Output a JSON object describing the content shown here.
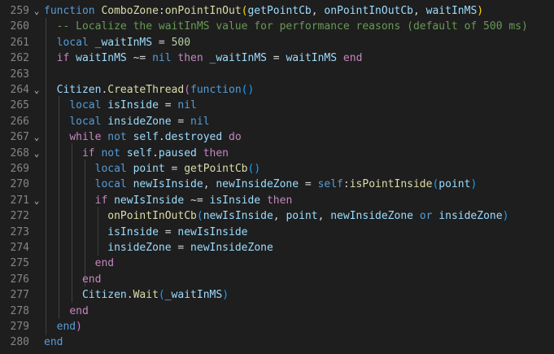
{
  "lines": [
    {
      "n": "259",
      "fold": "⌄",
      "t": [
        [
          "kw",
          "function"
        ],
        [
          "op",
          " "
        ],
        [
          "fn",
          "ComboZone"
        ],
        [
          "op",
          ":"
        ],
        [
          "fn",
          "onPointInOut"
        ],
        [
          "p1",
          "("
        ],
        [
          "var",
          "getPointCb"
        ],
        [
          "op",
          ", "
        ],
        [
          "var",
          "onPointInOutCb"
        ],
        [
          "op",
          ", "
        ],
        [
          "var",
          "waitInMS"
        ],
        [
          "p1",
          ")"
        ]
      ]
    },
    {
      "n": "260",
      "fold": "",
      "t": [
        [
          "op",
          "  "
        ],
        [
          "cm",
          "-- Localize the waitInMS value for performance reasons (default of 500 ms)"
        ]
      ]
    },
    {
      "n": "261",
      "fold": "",
      "t": [
        [
          "op",
          "  "
        ],
        [
          "kw",
          "local"
        ],
        [
          "op",
          " "
        ],
        [
          "var",
          "_waitInMS"
        ],
        [
          "op",
          " = "
        ],
        [
          "num",
          "500"
        ]
      ]
    },
    {
      "n": "262",
      "fold": "",
      "t": [
        [
          "op",
          "  "
        ],
        [
          "ctl",
          "if"
        ],
        [
          "op",
          " "
        ],
        [
          "var",
          "waitInMS"
        ],
        [
          "op",
          " ~= "
        ],
        [
          "kw",
          "nil"
        ],
        [
          "op",
          " "
        ],
        [
          "ctl",
          "then"
        ],
        [
          "op",
          " "
        ],
        [
          "var",
          "_waitInMS"
        ],
        [
          "op",
          " = "
        ],
        [
          "var",
          "waitInMS"
        ],
        [
          "op",
          " "
        ],
        [
          "ctl",
          "end"
        ]
      ]
    },
    {
      "n": "263",
      "fold": "",
      "t": []
    },
    {
      "n": "264",
      "fold": "⌄",
      "t": [
        [
          "op",
          "  "
        ],
        [
          "var",
          "Citizen"
        ],
        [
          "op",
          "."
        ],
        [
          "fn",
          "CreateThread"
        ],
        [
          "p2",
          "("
        ],
        [
          "kw",
          "function"
        ],
        [
          "p3",
          "()"
        ]
      ]
    },
    {
      "n": "265",
      "fold": "",
      "t": [
        [
          "op",
          "    "
        ],
        [
          "kw",
          "local"
        ],
        [
          "op",
          " "
        ],
        [
          "var",
          "isInside"
        ],
        [
          "op",
          " = "
        ],
        [
          "kw",
          "nil"
        ]
      ]
    },
    {
      "n": "266",
      "fold": "",
      "t": [
        [
          "op",
          "    "
        ],
        [
          "kw",
          "local"
        ],
        [
          "op",
          " "
        ],
        [
          "var",
          "insideZone"
        ],
        [
          "op",
          " = "
        ],
        [
          "kw",
          "nil"
        ]
      ]
    },
    {
      "n": "267",
      "fold": "⌄",
      "t": [
        [
          "op",
          "    "
        ],
        [
          "ctl",
          "while"
        ],
        [
          "op",
          " "
        ],
        [
          "kw",
          "not"
        ],
        [
          "op",
          " "
        ],
        [
          "var",
          "self"
        ],
        [
          "op",
          "."
        ],
        [
          "var",
          "destroyed"
        ],
        [
          "op",
          " "
        ],
        [
          "ctl",
          "do"
        ]
      ]
    },
    {
      "n": "268",
      "fold": "⌄",
      "t": [
        [
          "op",
          "      "
        ],
        [
          "ctl",
          "if"
        ],
        [
          "op",
          " "
        ],
        [
          "kw",
          "not"
        ],
        [
          "op",
          " "
        ],
        [
          "var",
          "self"
        ],
        [
          "op",
          "."
        ],
        [
          "var",
          "paused"
        ],
        [
          "op",
          " "
        ],
        [
          "ctl",
          "then"
        ]
      ]
    },
    {
      "n": "269",
      "fold": "",
      "t": [
        [
          "op",
          "        "
        ],
        [
          "kw",
          "local"
        ],
        [
          "op",
          " "
        ],
        [
          "var",
          "point"
        ],
        [
          "op",
          " = "
        ],
        [
          "fn",
          "getPointCb"
        ],
        [
          "p3",
          "()"
        ]
      ]
    },
    {
      "n": "270",
      "fold": "",
      "t": [
        [
          "op",
          "        "
        ],
        [
          "kw",
          "local"
        ],
        [
          "op",
          " "
        ],
        [
          "var",
          "newIsInside"
        ],
        [
          "op",
          ", "
        ],
        [
          "var",
          "newInsideZone"
        ],
        [
          "op",
          " = "
        ],
        [
          "kw",
          "self"
        ],
        [
          "op",
          ":"
        ],
        [
          "fn",
          "isPointInside"
        ],
        [
          "p3",
          "("
        ],
        [
          "var",
          "point"
        ],
        [
          "p3",
          ")"
        ]
      ]
    },
    {
      "n": "271",
      "fold": "⌄",
      "t": [
        [
          "op",
          "        "
        ],
        [
          "ctl",
          "if"
        ],
        [
          "op",
          " "
        ],
        [
          "var",
          "newIsInside"
        ],
        [
          "op",
          " ~= "
        ],
        [
          "var",
          "isInside"
        ],
        [
          "op",
          " "
        ],
        [
          "ctl",
          "then"
        ]
      ]
    },
    {
      "n": "272",
      "fold": "",
      "t": [
        [
          "op",
          "          "
        ],
        [
          "fn",
          "onPointInOutCb"
        ],
        [
          "p3",
          "("
        ],
        [
          "var",
          "newIsInside"
        ],
        [
          "op",
          ", "
        ],
        [
          "var",
          "point"
        ],
        [
          "op",
          ", "
        ],
        [
          "var",
          "newInsideZone"
        ],
        [
          "op",
          " "
        ],
        [
          "kw",
          "or"
        ],
        [
          "op",
          " "
        ],
        [
          "var",
          "insideZone"
        ],
        [
          "p3",
          ")"
        ]
      ]
    },
    {
      "n": "273",
      "fold": "",
      "t": [
        [
          "op",
          "          "
        ],
        [
          "var",
          "isInside"
        ],
        [
          "op",
          " = "
        ],
        [
          "var",
          "newIsInside"
        ]
      ]
    },
    {
      "n": "274",
      "fold": "",
      "t": [
        [
          "op",
          "          "
        ],
        [
          "var",
          "insideZone"
        ],
        [
          "op",
          " = "
        ],
        [
          "var",
          "newInsideZone"
        ]
      ]
    },
    {
      "n": "275",
      "fold": "",
      "t": [
        [
          "op",
          "        "
        ],
        [
          "ctl",
          "end"
        ]
      ]
    },
    {
      "n": "276",
      "fold": "",
      "t": [
        [
          "op",
          "      "
        ],
        [
          "ctl",
          "end"
        ]
      ]
    },
    {
      "n": "277",
      "fold": "",
      "t": [
        [
          "op",
          "      "
        ],
        [
          "var",
          "Citizen"
        ],
        [
          "op",
          "."
        ],
        [
          "fn",
          "Wait"
        ],
        [
          "p3",
          "("
        ],
        [
          "var",
          "_waitInMS"
        ],
        [
          "p3",
          ")"
        ]
      ]
    },
    {
      "n": "278",
      "fold": "",
      "t": [
        [
          "op",
          "    "
        ],
        [
          "ctl",
          "end"
        ]
      ]
    },
    {
      "n": "279",
      "fold": "",
      "t": [
        [
          "op",
          "  "
        ],
        [
          "kw",
          "end"
        ],
        [
          "p2",
          ")"
        ]
      ]
    },
    {
      "n": "280",
      "fold": "",
      "t": [
        [
          "kw",
          "end"
        ]
      ]
    }
  ]
}
